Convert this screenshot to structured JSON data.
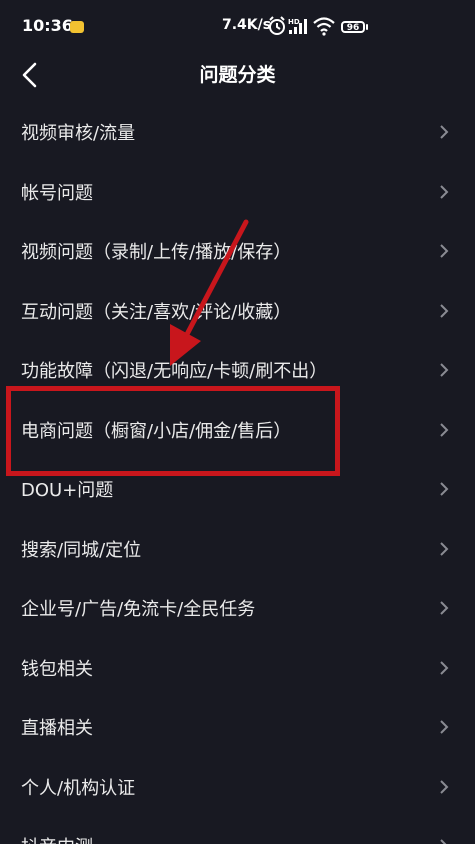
{
  "status_bar": {
    "time": "10:36",
    "network_speed": "7.4K/s",
    "battery": "96",
    "icons": [
      "notification-icon",
      "alarm-icon",
      "hd-icon",
      "signal-icon",
      "wifi-icon",
      "battery-icon"
    ]
  },
  "header": {
    "title": "问题分类",
    "back_icon": "chevron-left-icon"
  },
  "list": {
    "items": [
      {
        "label": "视频审核/流量"
      },
      {
        "label": "帐号问题"
      },
      {
        "label": "视频问题（录制/上传/播放/保存）"
      },
      {
        "label": "互动问题（关注/喜欢/评论/收藏）"
      },
      {
        "label": "功能故障（闪退/无响应/卡顿/刷不出）"
      },
      {
        "label": "电商问题（橱窗/小店/佣金/售后）"
      },
      {
        "label": "DOU+问题"
      },
      {
        "label": "搜索/同城/定位"
      },
      {
        "label": "企业号/广告/免流卡/全民任务"
      },
      {
        "label": "钱包相关"
      },
      {
        "label": "直播相关"
      },
      {
        "label": "个人/机构认证"
      },
      {
        "label": "抖音内测"
      }
    ]
  },
  "colors": {
    "background": "#181922",
    "text": "#eaeaea",
    "chevron": "#8a8b93",
    "annotation": "#c8161c"
  }
}
